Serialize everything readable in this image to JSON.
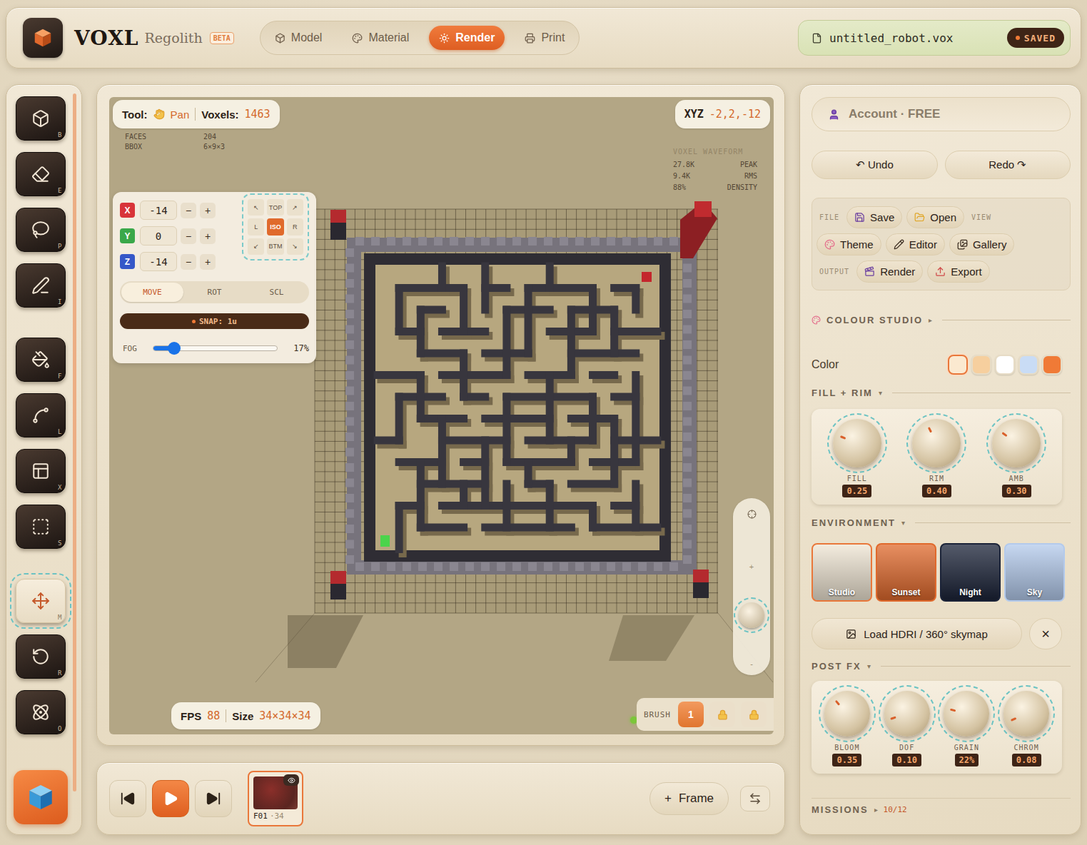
{
  "brand": {
    "name": "VOXL",
    "edition": "Regolith",
    "badge": "BETA"
  },
  "mode_tabs": [
    {
      "label": "Model",
      "selected": false
    },
    {
      "label": "Material",
      "selected": false
    },
    {
      "label": "Render",
      "selected": true
    },
    {
      "label": "Print",
      "selected": false
    }
  ],
  "file": {
    "name": "untitled_robot.vox",
    "status": "SAVED"
  },
  "tools": [
    {
      "key": "B",
      "selected": false
    },
    {
      "key": "E",
      "selected": false
    },
    {
      "key": "P",
      "selected": false
    },
    {
      "key": "I",
      "selected": false
    },
    {
      "key": "F",
      "selected": false
    },
    {
      "key": "L",
      "selected": false
    },
    {
      "key": "X",
      "selected": false
    },
    {
      "key": "S",
      "selected": false
    },
    {
      "key": "M",
      "selected": true
    },
    {
      "key": "R",
      "selected": false
    },
    {
      "key": "O",
      "selected": false
    }
  ],
  "viewport": {
    "tool_label": "Tool:",
    "tool": "Pan",
    "voxels_label": "Voxels:",
    "voxels": "1463",
    "stats": [
      {
        "label": "FACES",
        "value": "204"
      },
      {
        "label": "BBOX",
        "value": "6×9×3"
      }
    ],
    "xyz_label": "XYZ",
    "xyz": "-2,2,-12",
    "waveform": {
      "title": "VOXEL WAVEFORM",
      "rows": [
        {
          "value": "27.8K",
          "label": "PEAK"
        },
        {
          "value": "9.4K",
          "label": "RMS"
        },
        {
          "value": "88%",
          "label": "DENSITY"
        }
      ]
    },
    "axes": [
      {
        "axis": "X",
        "value": "-14",
        "color": "#d8343a"
      },
      {
        "axis": "Y",
        "value": "0",
        "color": "#3aa84a"
      },
      {
        "axis": "Z",
        "value": "-14",
        "color": "#3557c8"
      }
    ],
    "step_down": "−",
    "step_up": "+",
    "view_cube": [
      {
        "label": "↖",
        "selected": false
      },
      {
        "label": "TOP",
        "selected": false
      },
      {
        "label": "↗",
        "selected": false
      },
      {
        "label": "L",
        "selected": false
      },
      {
        "label": "ISO",
        "selected": true
      },
      {
        "label": "R",
        "selected": false
      },
      {
        "label": "↙",
        "selected": false
      },
      {
        "label": "BTM",
        "selected": false
      },
      {
        "label": "↘",
        "selected": false
      }
    ],
    "transform_modes": [
      {
        "label": "MOVE",
        "selected": true
      },
      {
        "label": "ROT",
        "selected": false
      },
      {
        "label": "SCL",
        "selected": false
      }
    ],
    "snap": "SNAP: 1u",
    "fog": {
      "label": "FOG",
      "level": 0.17,
      "reading": "17%"
    },
    "zoom": {
      "plus": "+",
      "minus": "-",
      "level": 0.34
    },
    "fps_label": "FPS",
    "fps": "88",
    "size_label": "Size",
    "size": "34×34×34",
    "brush": {
      "status_color": "#7cc63a",
      "label": "BRUSH",
      "value": "1"
    }
  },
  "timeline": {
    "frames": [
      {
        "label": "F01",
        "count": "·34",
        "selected": true
      }
    ],
    "add_icon": "+",
    "add_label": "Frame"
  },
  "account": "Account · FREE",
  "undo": "↶ Undo",
  "redo": "Redo ↷",
  "file_rows": [
    [
      {
        "kind": "label",
        "text": "FILE"
      },
      {
        "kind": "button",
        "text": "Save"
      },
      {
        "kind": "button",
        "text": "Open"
      },
      {
        "kind": "label",
        "text": "VIEW"
      }
    ],
    [
      {
        "kind": "button",
        "text": "Theme"
      },
      {
        "kind": "button",
        "text": "Editor"
      },
      {
        "kind": "button",
        "text": "Gallery"
      }
    ],
    [
      {
        "kind": "label",
        "text": "OUTPUT"
      },
      {
        "kind": "button",
        "text": "Render"
      },
      {
        "kind": "button",
        "text": "Export"
      }
    ]
  ],
  "colour_studio": {
    "title": "COLOUR STUDIO",
    "caret": "▸"
  },
  "color": {
    "label": "Color",
    "swatches": [
      {
        "color": "#fbe9d0",
        "selected": true
      },
      {
        "color": "#f6cf9e",
        "selected": false
      },
      {
        "color": "#ffffff",
        "selected": false
      },
      {
        "color": "#c9dcf5",
        "selected": false
      },
      {
        "color": "#f07a36",
        "selected": false
      }
    ]
  },
  "fill_rim": {
    "title": "FILL + RIM",
    "caret": "▾",
    "knobs": [
      {
        "label": "FILL",
        "value": "0.25",
        "level": 0.25
      },
      {
        "label": "RIM",
        "value": "0.40",
        "level": 0.4
      },
      {
        "label": "AMB",
        "value": "0.30",
        "level": 0.3
      }
    ]
  },
  "environment": {
    "title": "ENVIRONMENT",
    "caret": "▾",
    "presets": [
      {
        "label": "Studio",
        "color": "#efe5d3",
        "selected": true
      },
      {
        "label": "Sunset",
        "color": "#e0692c",
        "selected": false
      },
      {
        "label": "Night",
        "color": "#1b2338",
        "selected": false
      },
      {
        "label": "Sky",
        "color": "#b3caec",
        "selected": false
      }
    ]
  },
  "hdri": {
    "label": "Load HDRI / 360° skymap",
    "close": "×"
  },
  "post_fx": {
    "title": "POST FX",
    "caret": "▾",
    "knobs": [
      {
        "label": "BLOOM",
        "value": "0.35",
        "level": 0.35
      },
      {
        "label": "DOF",
        "value": "0.10",
        "level": 0.1
      },
      {
        "label": "GRAIN",
        "value": "22%",
        "level": 0.22
      },
      {
        "label": "CHROM",
        "value": "0.08",
        "level": 0.08
      }
    ]
  },
  "missions": {
    "title": "MISSIONS",
    "caret": "▸",
    "progress": "10/12"
  }
}
